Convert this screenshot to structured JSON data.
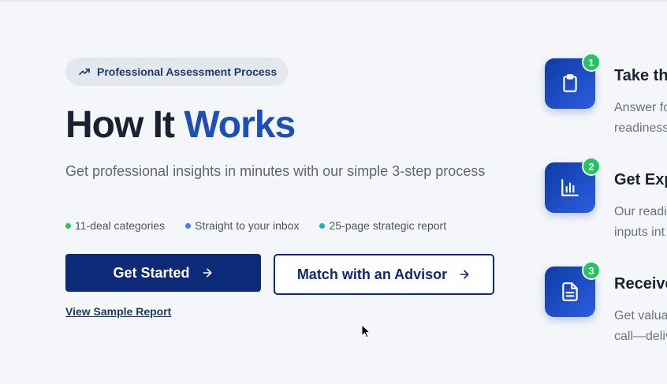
{
  "badge": {
    "label": "Professional Assessment Process",
    "icon": "trending-up-icon"
  },
  "heading": {
    "part1": "How It ",
    "part2": "Works"
  },
  "subtitle": "Get professional insights in minutes with our simple 3-step process",
  "features": [
    {
      "label": "11-deal categories",
      "color": "#22c55e"
    },
    {
      "label": "Straight to your inbox",
      "color": "#3b82f6"
    },
    {
      "label": "25-page strategic report",
      "color": "#14b8a6"
    }
  ],
  "buttons": {
    "primary": "Get Started",
    "secondary": "Match with an Advisor",
    "link": "View Sample Report"
  },
  "steps": [
    {
      "number": "1",
      "title": "Take th",
      "line1": "Answer fo",
      "line2": "readiness",
      "icon": "clipboard-icon"
    },
    {
      "number": "2",
      "title": "Get Exp",
      "line1": "Our readi",
      "line2": "inputs int",
      "icon": "bar-chart-icon"
    },
    {
      "number": "3",
      "title": "Receive",
      "line1": "Get valua",
      "line2": "call—deliv",
      "icon": "document-icon"
    }
  ],
  "colors": {
    "primary": "#0d2a78",
    "accent": "#1d4fb8",
    "success": "#22c55e",
    "background": "#f4f6f9"
  }
}
